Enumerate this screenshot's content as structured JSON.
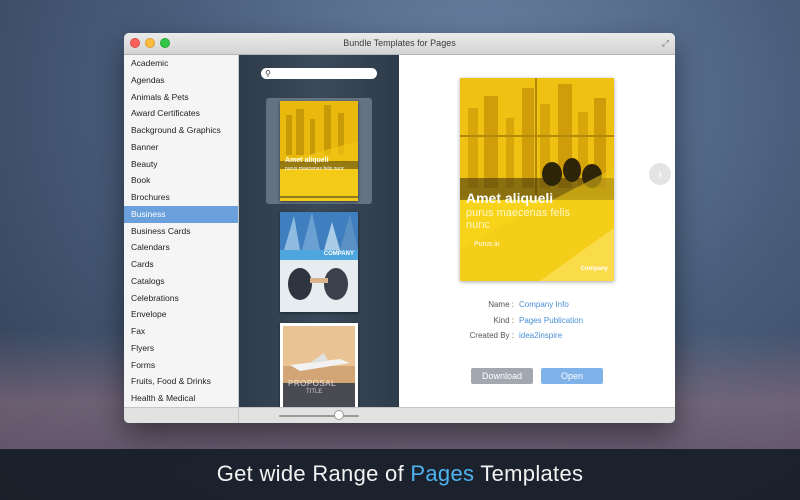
{
  "window": {
    "title": "Bundle Templates for Pages"
  },
  "sidebar": {
    "categories": [
      "Academic",
      "Agendas",
      "Animals & Pets",
      "Award Certificates",
      "Background & Graphics",
      "Banner",
      "Beauty",
      "Book",
      "Brochures",
      "Business",
      "Business Cards",
      "Calendars",
      "Cards",
      "Catalogs",
      "Celebrations",
      "Envelope",
      "Fax",
      "Flyers",
      "Forms",
      "Fruits, Food & Drinks",
      "Health & Medical"
    ],
    "selected_index": 9
  },
  "thumbnails": {
    "search": {
      "value": "",
      "placeholder": ""
    },
    "items": [
      {
        "title": "Amet aliqueli",
        "sub": "purus maecenas felis nunc"
      },
      {
        "title": "COMPANY",
        "sub": ""
      },
      {
        "title": "PROPOSAL",
        "sub": "TITLE"
      }
    ],
    "zoom_slider": 0.75
  },
  "preview": {
    "headline": "Amet aliqueli",
    "subline": "purus maecenas felis",
    "subline2": "nunc",
    "small_heading": "Purus in",
    "brand": "Company"
  },
  "details": {
    "name_label": "Name :",
    "name_value": "Company Info",
    "kind_label": "Kind :",
    "kind_value": "Pages Publication",
    "created_label": "Created By :",
    "created_value": "idea2inspire"
  },
  "buttons": {
    "download": "Download",
    "open": "Open"
  },
  "caption": {
    "part1": "Get wide Range of ",
    "highlight": "Pages",
    "part2": " Templates"
  },
  "colors": {
    "accent": "#6aa0dc",
    "highlight": "#4fb3f0",
    "template_yellow": "#f7d31a"
  }
}
